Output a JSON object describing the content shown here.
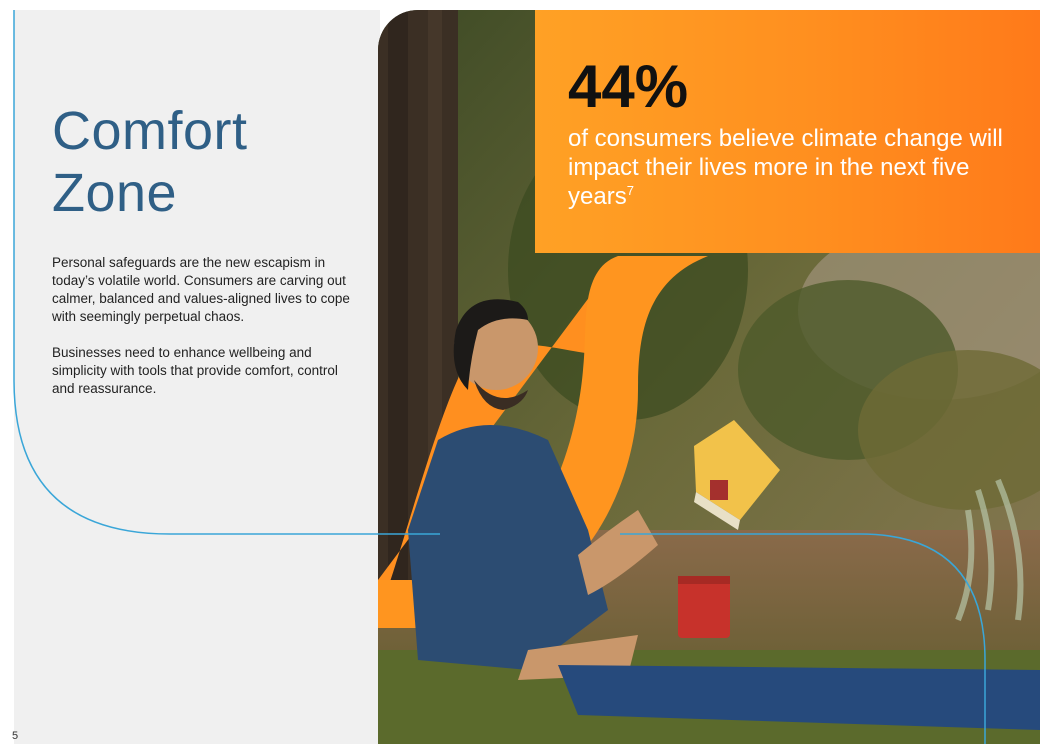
{
  "page": {
    "title_line1": "Comfort",
    "title_line2": "Zone",
    "paragraphs": [
      "Personal safeguards are the new escapism in today’s volatile world. Consumers are carving out calmer, balanced and values-aligned lives to cope with seemingly perpetual chaos.",
      "Businesses need to enhance wellbeing and simplicity with tools that provide comfort, control and reassurance."
    ],
    "page_number": "5"
  },
  "stat": {
    "value": "44%",
    "text": "of consumers believe climate change will impact their lives more in the next five years",
    "footnote": "7"
  },
  "colors": {
    "title": "#2f5f86",
    "accent_orange": "#ff8f1f",
    "line_blue": "#3aa6d8",
    "panel_gray": "#f0f0f0"
  }
}
